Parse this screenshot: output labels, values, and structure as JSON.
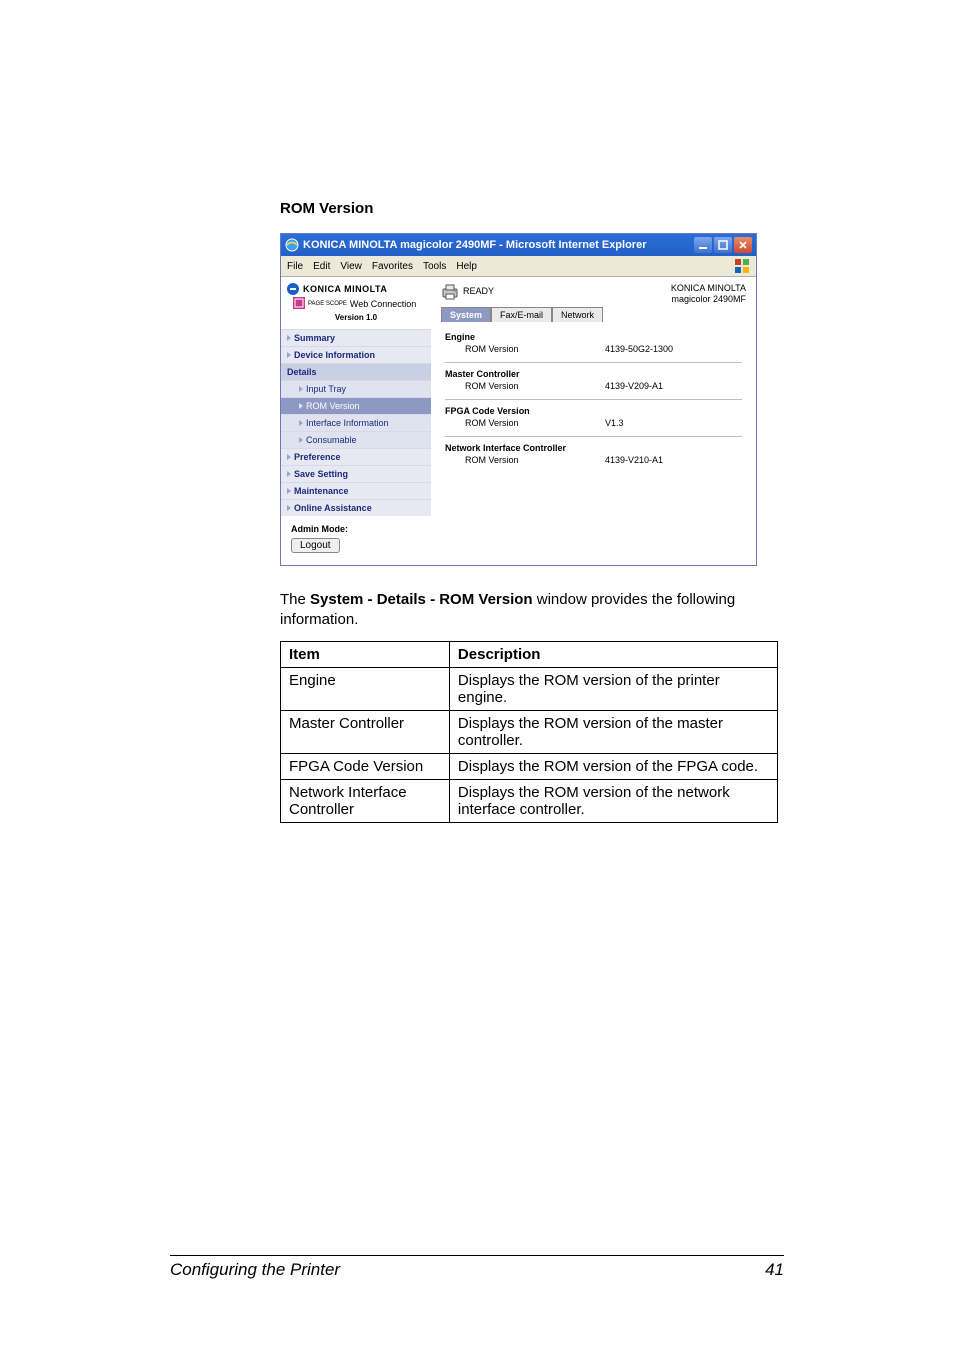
{
  "section_heading": "ROM Version",
  "window": {
    "title": "KONICA MINOLTA magicolor 2490MF - Microsoft Internet Explorer",
    "menus": [
      "File",
      "Edit",
      "View",
      "Favorites",
      "Tools",
      "Help"
    ]
  },
  "brand": {
    "name": "KONICA MINOLTA",
    "product_line": "Web Connection",
    "scope_prefix": "PAGE SCOPE",
    "version": "Version 1.0"
  },
  "sidebar": {
    "items": [
      {
        "label": "Summary",
        "type": "item"
      },
      {
        "label": "Device Information",
        "type": "item"
      },
      {
        "label": "Details",
        "type": "header"
      },
      {
        "label": "Input Tray",
        "type": "sub"
      },
      {
        "label": "ROM Version",
        "type": "selected"
      },
      {
        "label": "Interface Information",
        "type": "sub"
      },
      {
        "label": "Consumable",
        "type": "sub"
      },
      {
        "label": "Preference",
        "type": "item"
      },
      {
        "label": "Save Setting",
        "type": "item"
      },
      {
        "label": "Maintenance",
        "type": "item"
      },
      {
        "label": "Online Assistance",
        "type": "item"
      }
    ]
  },
  "status": {
    "ready": "READY",
    "maker": "KONICA MINOLTA",
    "model": "magicolor 2490MF"
  },
  "tabs": {
    "system": "System",
    "fax": "Fax/E-mail",
    "network": "Network"
  },
  "sections": {
    "engine": {
      "title": "Engine",
      "rom_label": "ROM Version",
      "rom_value": "4139-50G2-1300"
    },
    "master": {
      "title": "Master Controller",
      "rom_label": "ROM Version",
      "rom_value": "4139-V209-A1"
    },
    "fpga": {
      "title": "FPGA Code Version",
      "rom_label": "ROM Version",
      "rom_value": "V1.3"
    },
    "nic": {
      "title": "Network Interface Controller",
      "rom_label": "ROM Version",
      "rom_value": "4139-V210-A1"
    }
  },
  "admin": {
    "label": "Admin Mode:",
    "logout": "Logout"
  },
  "paragraph": {
    "pre": "The ",
    "bold": "System - Details - ROM Version",
    "post": " window provides the following information."
  },
  "table": {
    "head_item": "Item",
    "head_desc": "Description",
    "rows": [
      {
        "item": "Engine",
        "desc": "Displays the ROM version of the printer engine."
      },
      {
        "item": "Master Controller",
        "desc": "Displays the ROM version of the master controller."
      },
      {
        "item": "FPGA Code Version",
        "desc": "Displays the ROM version of the FPGA code."
      },
      {
        "item": "Network Interface Controller",
        "desc": "Displays the ROM version of the network interface controller."
      }
    ]
  },
  "footer": {
    "left": "Configuring the Printer",
    "page": "41"
  }
}
